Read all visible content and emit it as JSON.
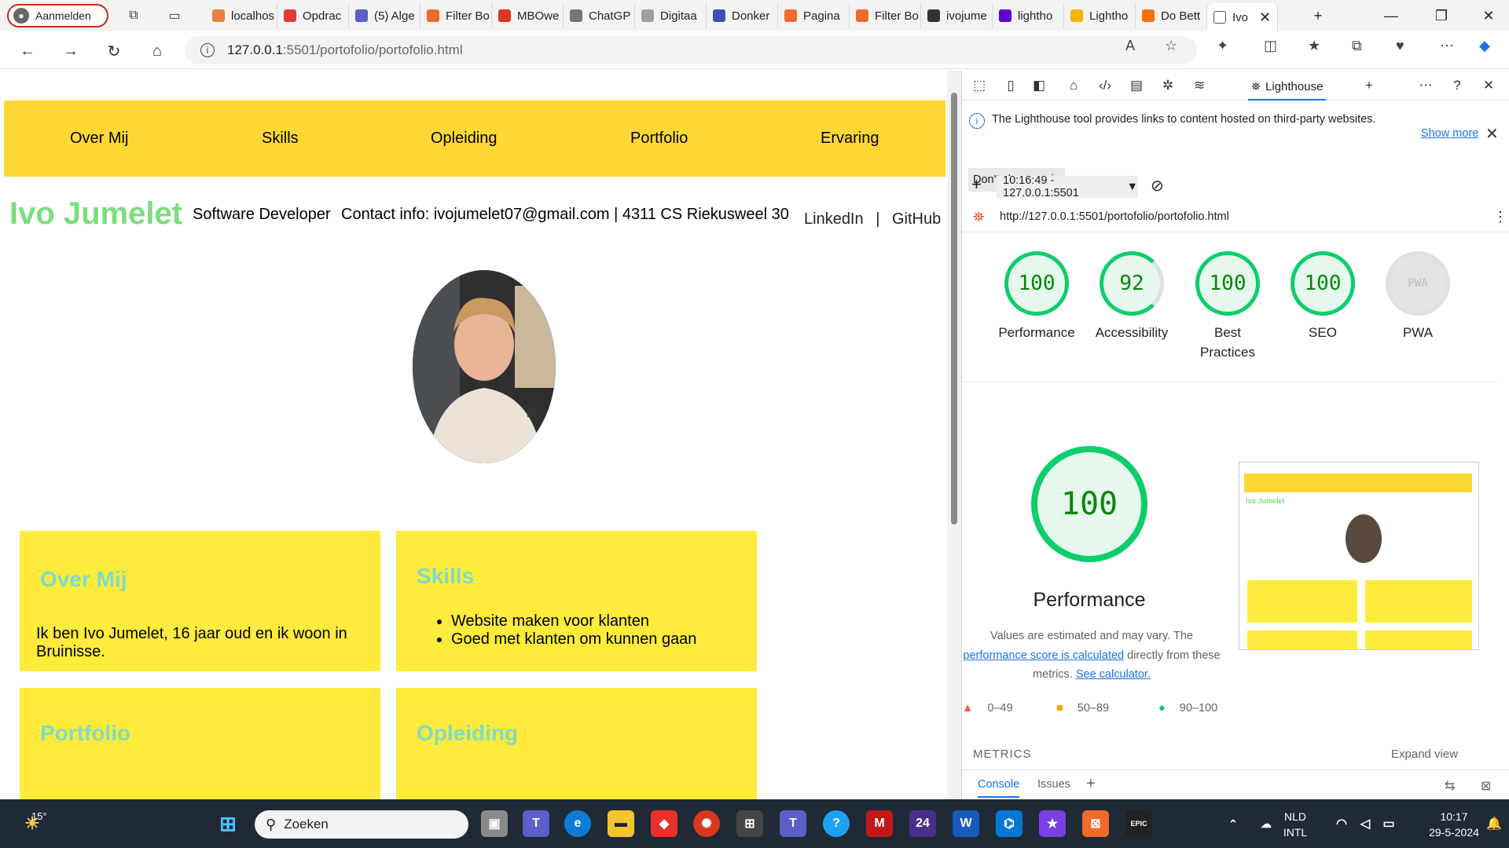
{
  "browser": {
    "profile_label": "Aanmelden",
    "tabs": [
      {
        "label": "localhos",
        "color": "#e8833a"
      },
      {
        "label": "Opdrac",
        "color": "#e33b3b"
      },
      {
        "label": "(5) Alge",
        "color": "#5b5fc7"
      },
      {
        "label": "Filter Bo",
        "color": "#f06a2a"
      },
      {
        "label": "MBOwe",
        "color": "#d9381e"
      },
      {
        "label": "ChatGP",
        "color": "#777777"
      },
      {
        "label": "Digitaa",
        "color": "#9aa0a6"
      },
      {
        "label": "Donker",
        "color": "#3f51b5"
      },
      {
        "label": "Pagina",
        "color": "#f06a2a"
      },
      {
        "label": "Filter Bo",
        "color": "#f06a2a"
      },
      {
        "label": "ivojume",
        "color": "#333333"
      },
      {
        "label": "lightho",
        "color": "#6001d2"
      },
      {
        "label": "Lightho",
        "color": "#f4b400"
      },
      {
        "label": "Do Bett",
        "color": "#ff6f00"
      },
      {
        "label": "Ivo",
        "color": "#ffffff"
      }
    ],
    "url_host": "127.0.0.1",
    "url_rest": ":5501/portofolio/portofolio.html"
  },
  "site": {
    "nav": [
      "Over Mij",
      "Skills",
      "Opleiding",
      "Portfolio",
      "Ervaring"
    ],
    "name": "Ivo Jumelet",
    "role": "Software Developer",
    "contact": "Contact info: ivojumelet07@gmail.com | 4311 CS Riekusweel 30",
    "link_linkedin": "LinkedIn",
    "link_sep": "|",
    "link_github": "GitHub",
    "about_title": "Over Mij",
    "about_text": "Ik ben Ivo Jumelet, 16 jaar oud en ik woon in Bruinisse.",
    "skills_title": "Skills",
    "skills": [
      "Website maken voor klanten",
      "Goed met klanten om kunnen gaan"
    ],
    "portfolio_title": "Portfolio",
    "education_title": "Opleiding",
    "accent_yellow": "#fdd835",
    "accent_green": "#7ddc7d"
  },
  "devtools": {
    "active_tab": "Lighthouse",
    "notice": "The Lighthouse tool provides links to content hosted on third-party websites.",
    "show_more": "Show more",
    "dont_show": "Don't show again",
    "report_select": "10:16:49 - 127.0.0.1:5501",
    "report_url": "http://127.0.0.1:5501/portofolio/portofolio.html",
    "scores": [
      {
        "value": "100",
        "label": "Performance"
      },
      {
        "value": "92",
        "label": "Accessibility"
      },
      {
        "value": "100",
        "label": "Best Practices"
      },
      {
        "value": "100",
        "label": "SEO"
      },
      {
        "value": "PWA",
        "label": "PWA"
      }
    ],
    "big_score": "100",
    "big_label": "Performance",
    "note_1": "Values are estimated and may vary. The",
    "note_link": "performance score is calculated",
    "note_2": "directly from these metrics.",
    "note_calc": "See calculator.",
    "legend": [
      "0–49",
      "50–89",
      "90–100"
    ],
    "metrics": "METRICS",
    "expand": "Expand view",
    "bottom_tabs": [
      "Console",
      "Issues"
    ]
  },
  "taskbar": {
    "weather": "15°",
    "search_placeholder": "Zoeken",
    "lang_1": "NLD",
    "lang_2": "INTL",
    "time": "10:17",
    "date": "29-5-2024"
  }
}
